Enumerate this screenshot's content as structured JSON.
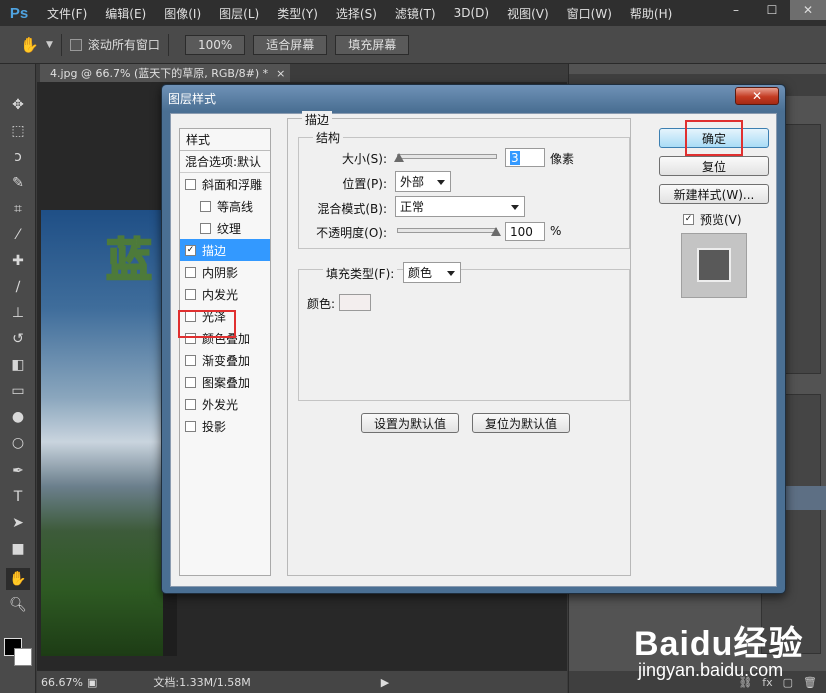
{
  "app": {
    "logo": "Ps",
    "menu": [
      "文件(F)",
      "编辑(E)",
      "图像(I)",
      "图层(L)",
      "类型(Y)",
      "选择(S)",
      "滤镜(T)",
      "3D(D)",
      "视图(V)",
      "窗口(W)",
      "帮助(H)"
    ],
    "window_controls": [
      "–",
      "☐",
      "✕"
    ]
  },
  "options_bar": {
    "scroll_all_label": "滚动所有窗口",
    "zoom_100_label": "100%",
    "fit_screen_label": "适合屏幕",
    "fill_screen_label": "填充屏幕"
  },
  "document": {
    "tab_title": "4.jpg @ 66.7% (蓝天下的草原, RGB/8#) *",
    "tab_close": "×",
    "canvas_text": "蓝"
  },
  "statusbar": {
    "zoom": "66.67%",
    "file_info": "文档:1.33M/1.58M"
  },
  "dialog": {
    "title": "图层样式",
    "close_label": "✕",
    "style_list": {
      "header": "样式",
      "blend_options": "混合选项:默认",
      "items": [
        {
          "label": "斜面和浮雕",
          "checked": false,
          "indent": false
        },
        {
          "label": "等高线",
          "checked": false,
          "indent": true
        },
        {
          "label": "纹理",
          "checked": false,
          "indent": true
        },
        {
          "label": "描边",
          "checked": true,
          "indent": false
        },
        {
          "label": "内阴影",
          "checked": false,
          "indent": false
        },
        {
          "label": "内发光",
          "checked": false,
          "indent": false
        },
        {
          "label": "光泽",
          "checked": false,
          "indent": false
        },
        {
          "label": "颜色叠加",
          "checked": false,
          "indent": false
        },
        {
          "label": "渐变叠加",
          "checked": false,
          "indent": false
        },
        {
          "label": "图案叠加",
          "checked": false,
          "indent": false
        },
        {
          "label": "外发光",
          "checked": false,
          "indent": false
        },
        {
          "label": "投影",
          "checked": false,
          "indent": false
        }
      ]
    },
    "stroke": {
      "section_title": "描边",
      "structure_title": "结构",
      "size_label": "大小(S):",
      "size_value": "3",
      "size_unit": "像素",
      "size_slider_fraction": 0.012,
      "position_label": "位置(P):",
      "position_value": "外部",
      "blend_mode_label": "混合模式(B):",
      "blend_mode_value": "正常",
      "opacity_label": "不透明度(O):",
      "opacity_value": "100",
      "opacity_unit": "%",
      "opacity_slider_fraction": 1.0,
      "fill_type_label": "填充类型(F):",
      "fill_type_value": "颜色",
      "color_label": "颜色:",
      "color_value": "#f3eeee",
      "set_default_label": "设置为默认值",
      "reset_default_label": "复位为默认值"
    },
    "buttons": {
      "ok": "确定",
      "reset": "复位",
      "new_style": "新建样式(W)...",
      "preview_label": "预览(V)",
      "preview_checked": true
    }
  },
  "watermark": {
    "brand": "Baidu经验",
    "url": "jingyan.baidu.com"
  },
  "colors": {
    "accent_selection": "#3399ff",
    "highlight_box": "#e03030",
    "dialog_frame": "#4a6f93"
  }
}
